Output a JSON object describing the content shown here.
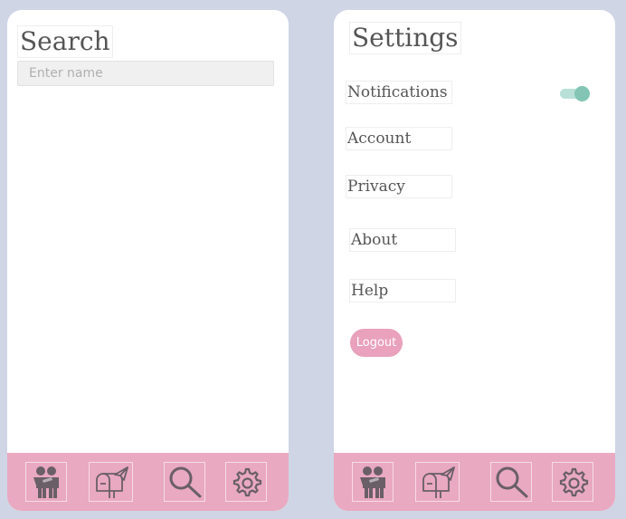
{
  "search": {
    "title": "Search",
    "input_placeholder": "Enter name",
    "input_value": ""
  },
  "settings": {
    "title": "Settings",
    "items": [
      {
        "label": "Notifications"
      },
      {
        "label": "Account"
      },
      {
        "label": "Privacy"
      },
      {
        "label": "About"
      },
      {
        "label": "Help"
      }
    ],
    "notifications_toggle_on": true,
    "logout_label": "Logout"
  },
  "tabbar": {
    "icons": [
      "friends-icon",
      "mailbox-icon",
      "search-icon",
      "gear-icon"
    ]
  },
  "colors": {
    "background": "#cfd5e5",
    "tabbar": "#e9a9c0",
    "logout": "#e9a1bc",
    "toggle_track": "#b9e0d8",
    "toggle_knob": "#82c5b5",
    "text": "#555555"
  }
}
